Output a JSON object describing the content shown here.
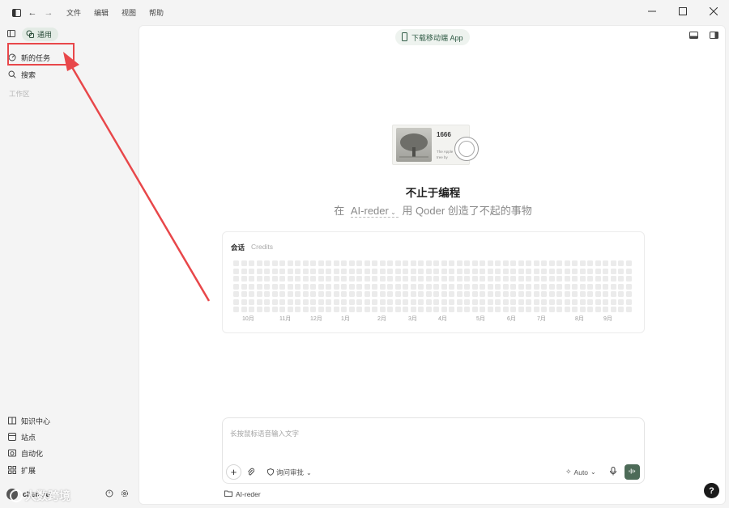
{
  "menu": [
    "文件",
    "编辑",
    "视图",
    "帮助"
  ],
  "sidebar": {
    "general_label": "通用",
    "new_task": "新的任务",
    "search": "搜索",
    "workspace_section": "工作区",
    "bottom_items": [
      {
        "label": "知识中心",
        "icon": "book-icon"
      },
      {
        "label": "站点",
        "icon": "site-icon"
      },
      {
        "label": "自动化",
        "icon": "automation-icon"
      },
      {
        "label": "扩展",
        "icon": "extensions-icon"
      }
    ],
    "user_name": "chen xu"
  },
  "main": {
    "download_app": "下载移动端 App",
    "hero_image_text": {
      "number": "1666",
      "line1": "The Apple",
      "line2": "tree by",
      "line3": "Bob Ross"
    },
    "title": "不止于编程",
    "subtitle_prefix": "在",
    "project": "AI-reder",
    "subtitle_suffix": "用 Qoder 创造了不起的事物"
  },
  "activity": {
    "tab_sessions": "会话",
    "tab_credits": "Credits",
    "weeks": 52,
    "days": 7,
    "months": [
      "10月",
      "11月",
      "12月",
      "1月",
      "2月",
      "3月",
      "4月",
      "5月",
      "6月",
      "7月",
      "8月",
      "9月"
    ]
  },
  "composer": {
    "placeholder": "长按鼠标语音输入文字",
    "mode_label": "询问审批",
    "model_label": "Auto",
    "folder": "AI-reder"
  },
  "help_label": "?",
  "watermark": "大数跨境",
  "colors": {
    "accent": "#4d6b58",
    "annotation": "#e8474a",
    "cell": "#ebebeb"
  }
}
